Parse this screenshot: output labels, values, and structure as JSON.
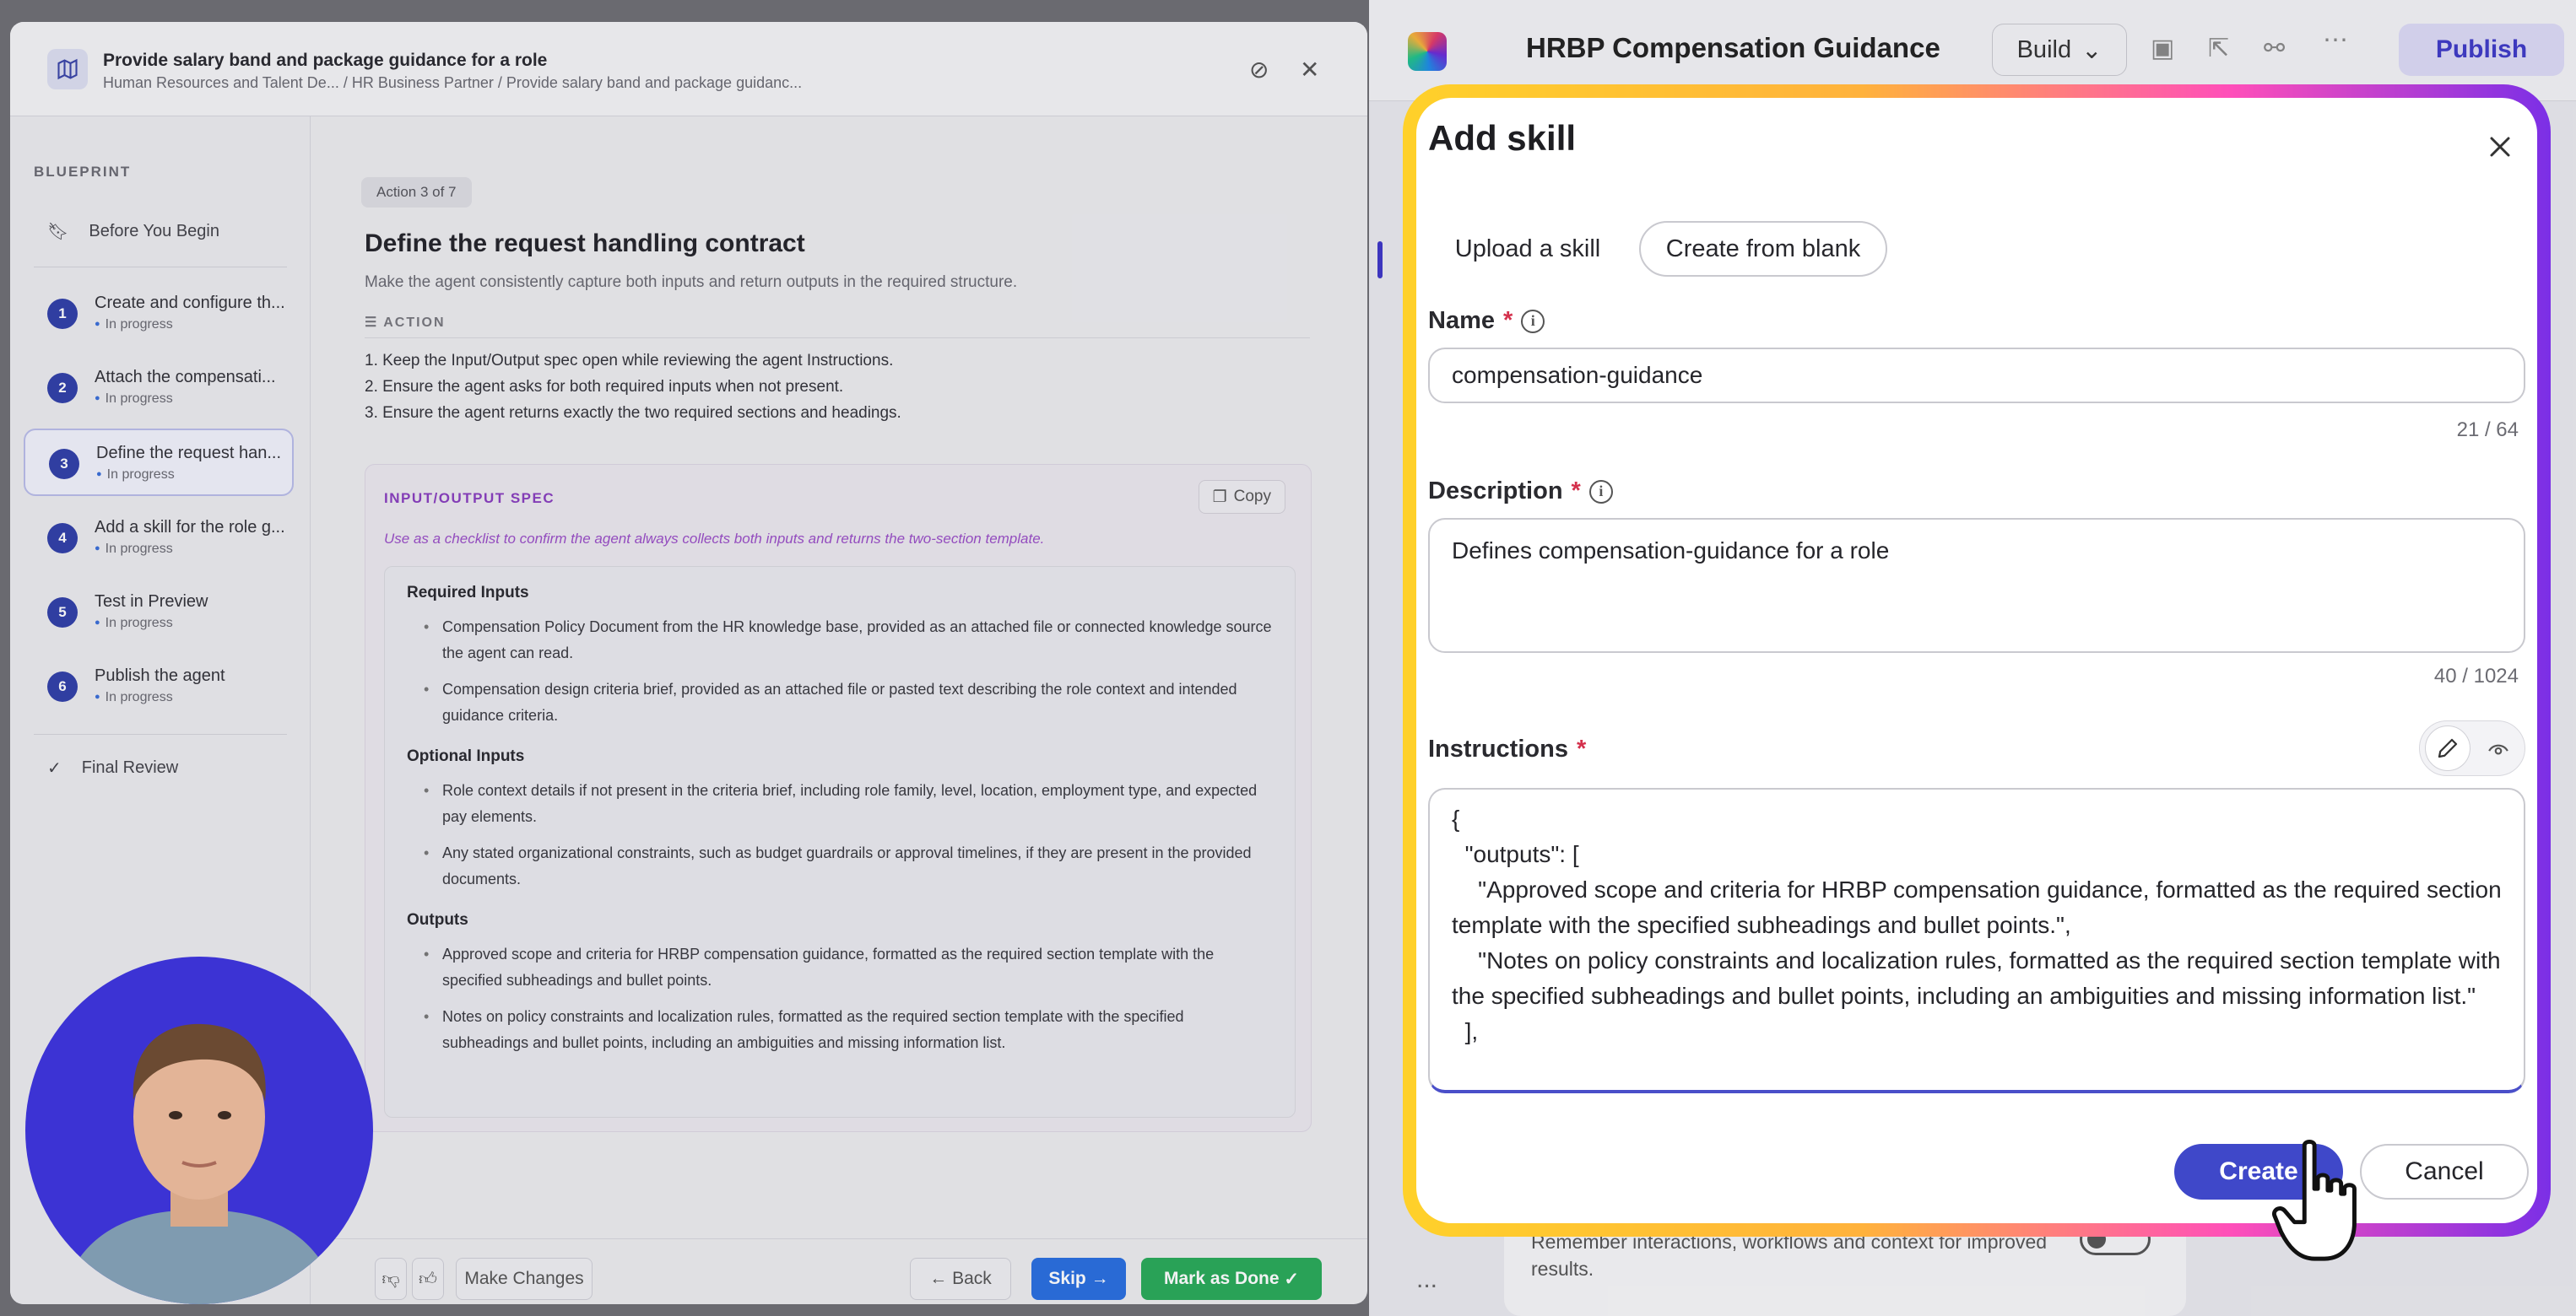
{
  "background_app": {
    "title": "HRBP Compensation Guidance",
    "build_label": "Build",
    "publish_label": "Publish",
    "memory_text": "Remember interactions, workflows and context for improved results.",
    "more_dots": "..."
  },
  "course_panel": {
    "title": "Provide salary band and package guidance for a role",
    "breadcrumb": "Human Resources and Talent De...  / HR Business Partner / Provide salary band and package guidanc...",
    "sidebar": {
      "section_label": "BLUEPRINT",
      "before": "Before You Begin",
      "steps": [
        {
          "num": "1",
          "label": "Create and configure th...",
          "status": "In progress"
        },
        {
          "num": "2",
          "label": "Attach the compensati...",
          "status": "In progress"
        },
        {
          "num": "3",
          "label": "Define the request han...",
          "status": "In progress"
        },
        {
          "num": "4",
          "label": "Add a skill for the role g...",
          "status": "In progress"
        },
        {
          "num": "5",
          "label": "Test in Preview",
          "status": "In progress"
        },
        {
          "num": "6",
          "label": "Publish the agent",
          "status": "In progress"
        }
      ],
      "final": "Final Review"
    },
    "main": {
      "action_pill": "Action 3 of 7",
      "title": "Define the request handling contract",
      "subtitle": "Make the agent consistently capture both inputs and return outputs in the required structure.",
      "action_label": "ACTION",
      "steps": [
        "1. Keep the Input/Output spec open while reviewing the agent Instructions.",
        "2. Ensure the agent asks for both required inputs when not present.",
        "3. Ensure the agent returns exactly the two required sections and headings."
      ],
      "spec": {
        "title": "INPUT/OUTPUT SPEC",
        "copy": "Copy",
        "note": "Use as a checklist to confirm the agent always collects both inputs and returns the two-section template.",
        "required_heading": "Required Inputs",
        "required": [
          "Compensation Policy Document from the HR knowledge base, provided as an attached file or connected knowledge source the agent can read.",
          "Compensation design criteria brief, provided as an attached file or pasted text describing the role context and intended guidance criteria."
        ],
        "optional_heading": "Optional Inputs",
        "optional": [
          "Role context details if not present in the criteria brief, including role family, level, location, employment type, and expected pay elements.",
          "Any stated organizational constraints, such as budget guardrails or approval timelines, if they are present in the provided documents."
        ],
        "outputs_heading": "Outputs",
        "outputs": [
          "Approved scope and criteria for HRBP compensation guidance, formatted as the required section template with the specified subheadings and bullet points.",
          "Notes on policy constraints and localization rules, formatted as the required section template with the specified subheadings and bullet points, including an ambiguities and missing information list."
        ]
      }
    },
    "footer": {
      "make_changes": "Make Changes",
      "back": "Back",
      "skip": "Skip",
      "done": "Mark as Done"
    }
  },
  "modal": {
    "title": "Add skill",
    "tab_upload": "Upload a skill",
    "tab_create": "Create from blank",
    "name_label": "Name",
    "name_value": "compensation-guidance",
    "name_count": "21 / 64",
    "desc_label": "Description",
    "desc_value": "Defines compensation-guidance for a role",
    "desc_count": "40 / 1024",
    "instr_label": "Instructions",
    "instr_value": "{\n  \"outputs\": [\n    \"Approved scope and criteria for HRBP compensation guidance, formatted as the required section template with the specified subheadings and bullet points.\",\n    \"Notes on policy constraints and localization rules, formatted as the required section template with the specified subheadings and bullet points, including an ambiguities and missing information list.\"\n  ],",
    "create": "Create",
    "cancel": "Cancel",
    "required_marker": "*"
  },
  "colors": {
    "accent": "#3f48c9",
    "glow_start": "#ffd12a",
    "glow_end": "#7b2fe6",
    "webcam_bg": "#3c33d4"
  }
}
